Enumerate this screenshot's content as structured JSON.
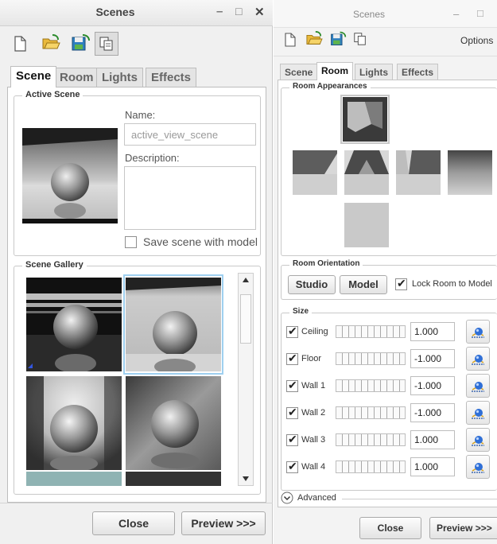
{
  "left": {
    "title": "Scenes",
    "controls": {
      "minimize": "–",
      "maximize": "□",
      "close": "✕"
    },
    "toolbar": [
      "new-icon",
      "open-folder-icon",
      "save-icon",
      "copy-icon"
    ],
    "tabs": [
      "Scene",
      "Room",
      "Lights",
      "Effects"
    ],
    "active_scene": {
      "group_label": "Active Scene",
      "name_label": "Name:",
      "name_value": "active_view_scene",
      "description_label": "Description:",
      "description_value": "",
      "save_checkbox_label": "Save scene with model",
      "save_checked": false
    },
    "gallery": {
      "group_label": "Scene Gallery"
    },
    "close_button": "Close",
    "preview_button": "Preview >>>"
  },
  "right": {
    "title": "Scenes",
    "controls": {
      "minimize": "–",
      "maximize": "□"
    },
    "options_label": "Options",
    "tabs": [
      "Scene",
      "Room",
      "Lights",
      "Effects"
    ],
    "room_appearances_label": "Room Appearances",
    "room_orientation": {
      "group_label": "Room Orientation",
      "studio_button": "Studio",
      "model_button": "Model",
      "lock_label": "Lock Room to Model",
      "lock_checked": true
    },
    "size": {
      "group_label": "Size",
      "rows": [
        {
          "label": "Ceiling",
          "value": "1.000",
          "checked": true
        },
        {
          "label": "Floor",
          "value": "-1.000",
          "checked": true
        },
        {
          "label": "Wall 1",
          "value": "-1.000",
          "checked": true
        },
        {
          "label": "Wall 2",
          "value": "-1.000",
          "checked": true
        },
        {
          "label": "Wall 3",
          "value": "1.000",
          "checked": true
        },
        {
          "label": "Wall 4",
          "value": "1.000",
          "checked": true
        }
      ]
    },
    "advanced_label": "Advanced",
    "close_button": "Close",
    "preview_button": "Preview >>>"
  }
}
